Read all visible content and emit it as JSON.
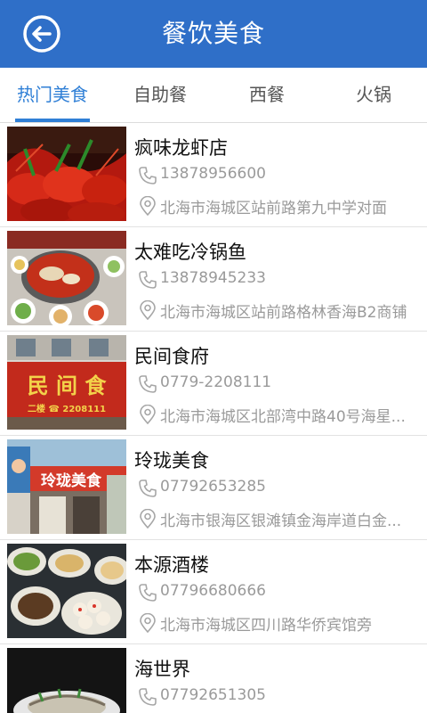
{
  "header": {
    "title": "餐饮美食",
    "back_icon": "back-arrow-icon"
  },
  "tabs": [
    {
      "label": "热门美食",
      "active": true
    },
    {
      "label": "自助餐",
      "active": false
    },
    {
      "label": "西餐",
      "active": false
    },
    {
      "label": "火锅",
      "active": false
    }
  ],
  "list": [
    {
      "name": "疯味龙虾店",
      "phone": "13878956600",
      "address": "北海市海城区站前路第九中学对面"
    },
    {
      "name": "太难吃冷锅鱼",
      "phone": "13878945233",
      "address": "北海市海城区站前路格林香海B2商铺"
    },
    {
      "name": "民间食府",
      "phone": "0779-2208111",
      "address": "北海市海城区北部湾中路40号海星..."
    },
    {
      "name": "玲珑美食",
      "phone": "07792653285",
      "address": "北海市银海区银滩镇金海岸道白金..."
    },
    {
      "name": "本源酒楼",
      "phone": "07796680666",
      "address": "北海市海城区四川路华侨宾馆旁"
    },
    {
      "name": "海世界",
      "phone": "07792651305",
      "address": ""
    }
  ],
  "images": {
    "0": {
      "sign": ""
    },
    "1": {
      "sign": ""
    },
    "2": {
      "sign": "民 间 食",
      "sub": "二楼 ☎ 2208111"
    },
    "3": {
      "sign": "玲珑美食",
      "sub": ""
    }
  },
  "icons": {
    "phone": "phone-icon",
    "location": "location-pin-icon"
  },
  "colors": {
    "header_bg": "#2f6fc8",
    "tab_active": "#2f7fd6",
    "secondary_text": "#9a9a9a"
  }
}
